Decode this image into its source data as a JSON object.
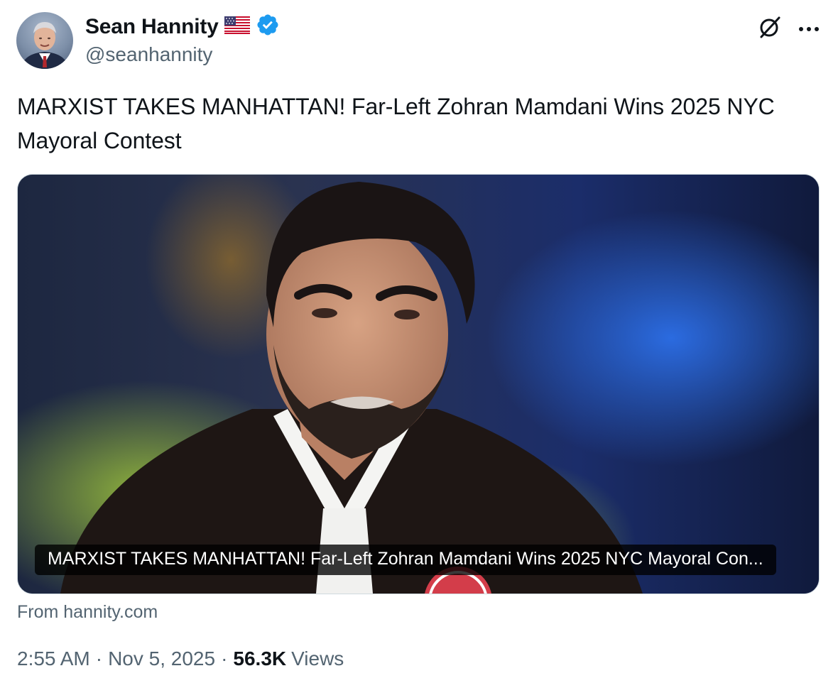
{
  "author": {
    "display_name": "Sean Hannity",
    "handle": "@seanhannity",
    "flag_icon": "us-flag-icon",
    "verified_icon": "verified-badge-icon",
    "verified_color": "#1d9bf0"
  },
  "actions": {
    "grok_icon": "grok-icon",
    "more_icon": "more-icon"
  },
  "tweet": {
    "text": "MARXIST TAKES MANHATTAN! Far-Left Zohran Mamdani Wins 2025 NYC Mayoral Contest"
  },
  "card": {
    "caption": "MARXIST TAKES MANHATTAN! Far-Left Zohran Mamdani Wins 2025 NYC Mayoral Con...",
    "source": "From hannity.com"
  },
  "meta": {
    "time": "2:55 AM",
    "separator": "·",
    "date": "Nov 5, 2025",
    "views_count": "56.3K",
    "views_label": "Views"
  }
}
